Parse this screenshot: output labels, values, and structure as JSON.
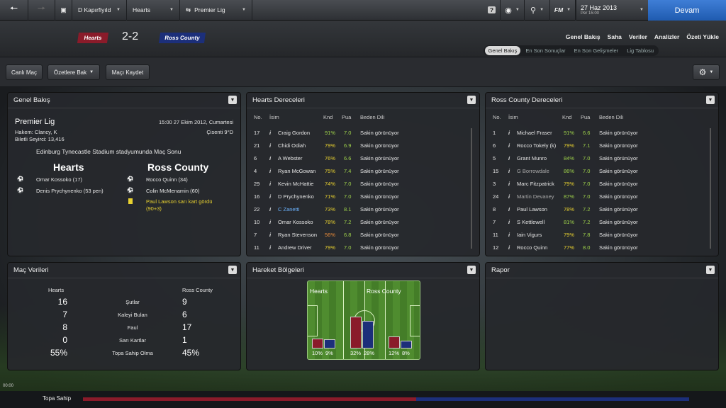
{
  "topbar": {
    "nav": [
      "D Kapırfiyıld",
      "Hearts",
      "Premier Lig"
    ],
    "date": "27 Haz 2013",
    "date_sub": "Per 15:00",
    "fm_label": "FM",
    "continue": "Devam"
  },
  "match": {
    "home": "Hearts",
    "away": "Ross County",
    "score": "2-2"
  },
  "header_nav": [
    "Genel Bakış",
    "Saha",
    "Veriler",
    "Analizler",
    "Özeti Yükle"
  ],
  "subtabs": [
    "Genel Bakış",
    "En Son Sonuçlar",
    "En Son Gelişmeler",
    "Lig Tablosu"
  ],
  "toolbar": {
    "live": "Canlı Maç",
    "highlights": "Özetlere Bak",
    "save": "Maçı Kaydet"
  },
  "overview": {
    "title": "Genel Bakış",
    "league": "Premier Lig",
    "datetime": "15:00 27 Ekim 2012, Cumartesi",
    "referee": "Hakem: Clancy, K",
    "weather": "Çisenti 9°D",
    "attendance": "Biletli Seyirci: 13,416",
    "venue": "Edinburg Tynecastle Stadium stadyumunda Maç Sonu",
    "home": "Hearts",
    "away": "Ross County",
    "home_events": [
      "Omar Kossoko (17)",
      "Denis Prychynenko (53 pen)"
    ],
    "away_events": [
      "Rocco Quinn (34)",
      "Colin McMenamin (60)"
    ],
    "card_event": "Paul Lawson sarı kart gördü (90+3)"
  },
  "hearts_ratings": {
    "title": "Hearts Dereceleri",
    "headers": [
      "No.",
      "İsim",
      "Knd",
      "Pua",
      "Beden Dili"
    ],
    "rows": [
      {
        "no": "17",
        "name": "Craig Gordon",
        "knd": "91%",
        "pua": "7.0",
        "body": "Sakin görünüyor"
      },
      {
        "no": "21",
        "name": "Chidi Odiah",
        "knd": "79%",
        "pua": "6.9",
        "body": "Sakin görünüyor"
      },
      {
        "no": "6",
        "name": "A Webster",
        "knd": "76%",
        "pua": "6.6",
        "body": "Sakin görünüyor"
      },
      {
        "no": "4",
        "name": "Ryan McGowan",
        "knd": "75%",
        "pua": "7.4",
        "body": "Sakin görünüyor"
      },
      {
        "no": "29",
        "name": "Kevin McHattie",
        "knd": "74%",
        "pua": "7.0",
        "body": "Sakin görünüyor"
      },
      {
        "no": "16",
        "name": "D Prychynenko",
        "knd": "71%",
        "pua": "7.0",
        "body": "Sakin görünüyor"
      },
      {
        "no": "22",
        "name": "C Zanetti",
        "knd": "73%",
        "pua": "8.1",
        "body": "Sakin görünüyor"
      },
      {
        "no": "10",
        "name": "Omar Kossoko",
        "knd": "78%",
        "pua": "7.2",
        "body": "Sakin görünüyor"
      },
      {
        "no": "7",
        "name": "Ryan Stevenson",
        "knd": "56%",
        "pua": "6.8",
        "body": "Sakin görünüyor"
      },
      {
        "no": "11",
        "name": "Andrew Driver",
        "knd": "79%",
        "pua": "7.0",
        "body": "Sakin görünüyor"
      }
    ]
  },
  "ross_ratings": {
    "title": "Ross County Dereceleri",
    "headers": [
      "No.",
      "İsim",
      "Knd",
      "Pua",
      "Beden Dili"
    ],
    "rows": [
      {
        "no": "1",
        "name": "Michael Fraser",
        "knd": "91%",
        "pua": "6.6",
        "body": "Sakin görünüyor"
      },
      {
        "no": "6",
        "name": "Rocco Tokely (k)",
        "knd": "79%",
        "pua": "7.1",
        "body": "Sakin görünüyor"
      },
      {
        "no": "5",
        "name": "Grant Munro",
        "knd": "84%",
        "pua": "7.0",
        "body": "Sakin görünüyor"
      },
      {
        "no": "15",
        "name": "G Borrowdale",
        "knd": "86%",
        "pua": "7.0",
        "body": "Sakin görünüyor"
      },
      {
        "no": "3",
        "name": "Marc Fitzpatrick",
        "knd": "79%",
        "pua": "7.0",
        "body": "Sakin görünüyor"
      },
      {
        "no": "24",
        "name": "Martin Devaney",
        "knd": "87%",
        "pua": "7.0",
        "body": "Sakin görünüyor"
      },
      {
        "no": "8",
        "name": "Paul Lawson",
        "knd": "78%",
        "pua": "7.2",
        "body": "Sakin görünüyor"
      },
      {
        "no": "7",
        "name": "S Kettlewell",
        "knd": "81%",
        "pua": "7.2",
        "body": "Sakin görünüyor"
      },
      {
        "no": "11",
        "name": "Iain Vigurs",
        "knd": "79%",
        "pua": "7.8",
        "body": "Sakin görünüyor"
      },
      {
        "no": "12",
        "name": "Rocco Quinn",
        "knd": "77%",
        "pua": "8.0",
        "body": "Sakin görünüyor"
      }
    ]
  },
  "match_stats": {
    "title": "Maç Verileri",
    "home": "Hearts",
    "away": "Ross County",
    "rows": [
      {
        "home": "16",
        "label": "Şutlar",
        "away": "9"
      },
      {
        "home": "7",
        "label": "Kaleyi Bulan",
        "away": "6"
      },
      {
        "home": "8",
        "label": "Faul",
        "away": "17"
      },
      {
        "home": "0",
        "label": "Sarı Kartlar",
        "away": "1"
      },
      {
        "home": "55%",
        "label": "Topa Sahip Olma",
        "away": "45%"
      }
    ]
  },
  "heatzones": {
    "title": "Hareket Bölgeleri",
    "home": "Hearts",
    "away": "Ross County",
    "zones": [
      {
        "home": "10%",
        "away": "9%"
      },
      {
        "home": "32%",
        "away": "28%"
      },
      {
        "home": "12%",
        "away": "8%"
      }
    ]
  },
  "report": {
    "title": "Rapor"
  },
  "bottom": {
    "time": "00:00",
    "possession": "Topa Sahip"
  },
  "colors": {
    "home": "#8a1b2a",
    "away": "#1c2f7a",
    "accent": "#2a6fc8"
  }
}
